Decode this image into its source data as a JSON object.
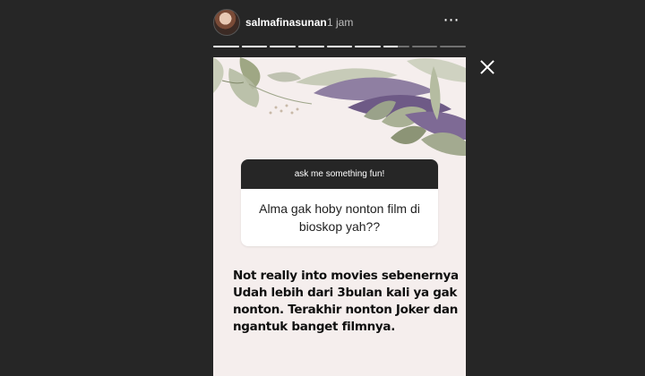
{
  "header": {
    "username": "salmafinasunan",
    "time": "1 jam",
    "more_icon": "⋯"
  },
  "progress": {
    "segments": 9,
    "current_index": 6,
    "current_progress": 0.55
  },
  "story": {
    "question_header": "ask me something fun!",
    "question_text": "Alma gak hoby nonton film di bioskop yah??",
    "answer_lines": [
      "Not really into movies sebenernya",
      "Udah lebih dari 3bulan kali ya gak",
      "nonton. Terakhir nonton Joker dan",
      "ngantuk banget filmnya."
    ]
  },
  "colors": {
    "background": "#262626",
    "story_bg": "#f5eeed",
    "question_header_bg": "#262626"
  },
  "icons": {
    "close": "close-icon",
    "more": "more-icon",
    "avatar": "avatar"
  }
}
